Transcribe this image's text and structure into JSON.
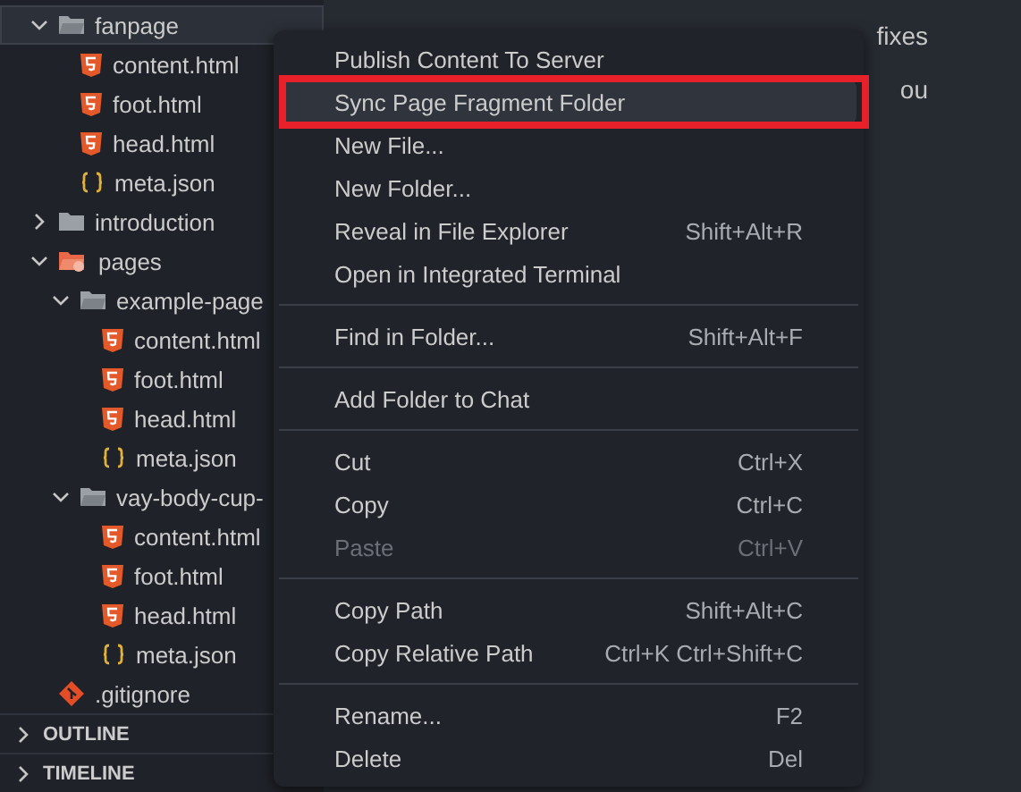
{
  "tree": [
    {
      "name": "fanpage",
      "kind": "folder",
      "expanded": true,
      "selected": true,
      "children": [
        {
          "name": "content.html",
          "kind": "html"
        },
        {
          "name": "foot.html",
          "kind": "html"
        },
        {
          "name": "head.html",
          "kind": "html"
        },
        {
          "name": "meta.json",
          "kind": "json"
        }
      ]
    },
    {
      "name": "introduction",
      "kind": "folder",
      "expanded": false,
      "selected": false
    },
    {
      "name": "pages",
      "kind": "special-folder",
      "expanded": true,
      "selected": false,
      "children": [
        {
          "name": "example-page",
          "kind": "folder",
          "expanded": true,
          "selected": false,
          "children": [
            {
              "name": "content.html",
              "kind": "html"
            },
            {
              "name": "foot.html",
              "kind": "html"
            },
            {
              "name": "head.html",
              "kind": "html"
            },
            {
              "name": "meta.json",
              "kind": "json"
            }
          ]
        },
        {
          "name": "vay-body-cup-",
          "kind": "folder",
          "expanded": true,
          "selected": false,
          "children": [
            {
              "name": "content.html",
              "kind": "html"
            },
            {
              "name": "foot.html",
              "kind": "html"
            },
            {
              "name": "head.html",
              "kind": "html"
            },
            {
              "name": "meta.json",
              "kind": "json"
            }
          ]
        }
      ]
    },
    {
      "name": ".gitignore",
      "kind": "git"
    }
  ],
  "sections": [
    {
      "title": "OUTLINE",
      "expanded": false
    },
    {
      "title": "TIMELINE",
      "expanded": false
    }
  ],
  "editor_texts": [
    "fixes",
    "ou"
  ],
  "context_menu": [
    [
      {
        "label": "Publish Content To Server",
        "selected": false,
        "disabled": false
      },
      {
        "label": "Sync Page Fragment Folder",
        "selected": true,
        "disabled": false,
        "annotated": true
      },
      {
        "label": "New File...",
        "selected": false,
        "disabled": false
      },
      {
        "label": "New Folder...",
        "selected": false,
        "disabled": false
      },
      {
        "label": "Reveal in File Explorer",
        "shortcut": "Shift+Alt+R",
        "selected": false,
        "disabled": false
      },
      {
        "label": "Open in Integrated Terminal",
        "selected": false,
        "disabled": false
      }
    ],
    [
      {
        "label": "Find in Folder...",
        "shortcut": "Shift+Alt+F",
        "selected": false,
        "disabled": false
      }
    ],
    [
      {
        "label": "Add Folder to Chat",
        "selected": false,
        "disabled": false
      }
    ],
    [
      {
        "label": "Cut",
        "shortcut": "Ctrl+X",
        "selected": false,
        "disabled": false
      },
      {
        "label": "Copy",
        "shortcut": "Ctrl+C",
        "selected": false,
        "disabled": false
      },
      {
        "label": "Paste",
        "shortcut": "Ctrl+V",
        "selected": false,
        "disabled": true
      }
    ],
    [
      {
        "label": "Copy Path",
        "shortcut": "Shift+Alt+C",
        "selected": false,
        "disabled": false
      },
      {
        "label": "Copy Relative Path",
        "shortcut": "Ctrl+K Ctrl+Shift+C",
        "selected": false,
        "disabled": false
      }
    ],
    [
      {
        "label": "Rename...",
        "shortcut": "F2",
        "selected": false,
        "disabled": false
      },
      {
        "label": "Delete",
        "shortcut": "Del",
        "selected": false,
        "disabled": false
      }
    ]
  ]
}
